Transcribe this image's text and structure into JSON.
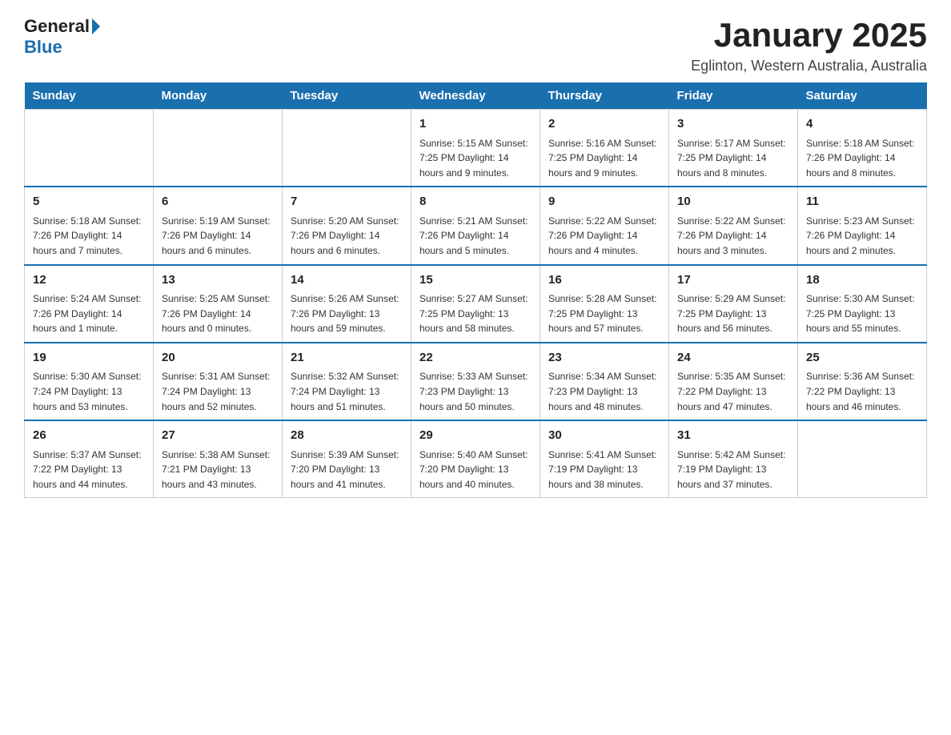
{
  "header": {
    "logo_general": "General",
    "logo_blue": "Blue",
    "month_title": "January 2025",
    "location": "Eglinton, Western Australia, Australia"
  },
  "days_of_week": [
    "Sunday",
    "Monday",
    "Tuesday",
    "Wednesday",
    "Thursday",
    "Friday",
    "Saturday"
  ],
  "weeks": [
    [
      {
        "day": "",
        "info": ""
      },
      {
        "day": "",
        "info": ""
      },
      {
        "day": "",
        "info": ""
      },
      {
        "day": "1",
        "info": "Sunrise: 5:15 AM\nSunset: 7:25 PM\nDaylight: 14 hours and 9 minutes."
      },
      {
        "day": "2",
        "info": "Sunrise: 5:16 AM\nSunset: 7:25 PM\nDaylight: 14 hours and 9 minutes."
      },
      {
        "day": "3",
        "info": "Sunrise: 5:17 AM\nSunset: 7:25 PM\nDaylight: 14 hours and 8 minutes."
      },
      {
        "day": "4",
        "info": "Sunrise: 5:18 AM\nSunset: 7:26 PM\nDaylight: 14 hours and 8 minutes."
      }
    ],
    [
      {
        "day": "5",
        "info": "Sunrise: 5:18 AM\nSunset: 7:26 PM\nDaylight: 14 hours and 7 minutes."
      },
      {
        "day": "6",
        "info": "Sunrise: 5:19 AM\nSunset: 7:26 PM\nDaylight: 14 hours and 6 minutes."
      },
      {
        "day": "7",
        "info": "Sunrise: 5:20 AM\nSunset: 7:26 PM\nDaylight: 14 hours and 6 minutes."
      },
      {
        "day": "8",
        "info": "Sunrise: 5:21 AM\nSunset: 7:26 PM\nDaylight: 14 hours and 5 minutes."
      },
      {
        "day": "9",
        "info": "Sunrise: 5:22 AM\nSunset: 7:26 PM\nDaylight: 14 hours and 4 minutes."
      },
      {
        "day": "10",
        "info": "Sunrise: 5:22 AM\nSunset: 7:26 PM\nDaylight: 14 hours and 3 minutes."
      },
      {
        "day": "11",
        "info": "Sunrise: 5:23 AM\nSunset: 7:26 PM\nDaylight: 14 hours and 2 minutes."
      }
    ],
    [
      {
        "day": "12",
        "info": "Sunrise: 5:24 AM\nSunset: 7:26 PM\nDaylight: 14 hours and 1 minute."
      },
      {
        "day": "13",
        "info": "Sunrise: 5:25 AM\nSunset: 7:26 PM\nDaylight: 14 hours and 0 minutes."
      },
      {
        "day": "14",
        "info": "Sunrise: 5:26 AM\nSunset: 7:26 PM\nDaylight: 13 hours and 59 minutes."
      },
      {
        "day": "15",
        "info": "Sunrise: 5:27 AM\nSunset: 7:25 PM\nDaylight: 13 hours and 58 minutes."
      },
      {
        "day": "16",
        "info": "Sunrise: 5:28 AM\nSunset: 7:25 PM\nDaylight: 13 hours and 57 minutes."
      },
      {
        "day": "17",
        "info": "Sunrise: 5:29 AM\nSunset: 7:25 PM\nDaylight: 13 hours and 56 minutes."
      },
      {
        "day": "18",
        "info": "Sunrise: 5:30 AM\nSunset: 7:25 PM\nDaylight: 13 hours and 55 minutes."
      }
    ],
    [
      {
        "day": "19",
        "info": "Sunrise: 5:30 AM\nSunset: 7:24 PM\nDaylight: 13 hours and 53 minutes."
      },
      {
        "day": "20",
        "info": "Sunrise: 5:31 AM\nSunset: 7:24 PM\nDaylight: 13 hours and 52 minutes."
      },
      {
        "day": "21",
        "info": "Sunrise: 5:32 AM\nSunset: 7:24 PM\nDaylight: 13 hours and 51 minutes."
      },
      {
        "day": "22",
        "info": "Sunrise: 5:33 AM\nSunset: 7:23 PM\nDaylight: 13 hours and 50 minutes."
      },
      {
        "day": "23",
        "info": "Sunrise: 5:34 AM\nSunset: 7:23 PM\nDaylight: 13 hours and 48 minutes."
      },
      {
        "day": "24",
        "info": "Sunrise: 5:35 AM\nSunset: 7:22 PM\nDaylight: 13 hours and 47 minutes."
      },
      {
        "day": "25",
        "info": "Sunrise: 5:36 AM\nSunset: 7:22 PM\nDaylight: 13 hours and 46 minutes."
      }
    ],
    [
      {
        "day": "26",
        "info": "Sunrise: 5:37 AM\nSunset: 7:22 PM\nDaylight: 13 hours and 44 minutes."
      },
      {
        "day": "27",
        "info": "Sunrise: 5:38 AM\nSunset: 7:21 PM\nDaylight: 13 hours and 43 minutes."
      },
      {
        "day": "28",
        "info": "Sunrise: 5:39 AM\nSunset: 7:20 PM\nDaylight: 13 hours and 41 minutes."
      },
      {
        "day": "29",
        "info": "Sunrise: 5:40 AM\nSunset: 7:20 PM\nDaylight: 13 hours and 40 minutes."
      },
      {
        "day": "30",
        "info": "Sunrise: 5:41 AM\nSunset: 7:19 PM\nDaylight: 13 hours and 38 minutes."
      },
      {
        "day": "31",
        "info": "Sunrise: 5:42 AM\nSunset: 7:19 PM\nDaylight: 13 hours and 37 minutes."
      },
      {
        "day": "",
        "info": ""
      }
    ]
  ]
}
